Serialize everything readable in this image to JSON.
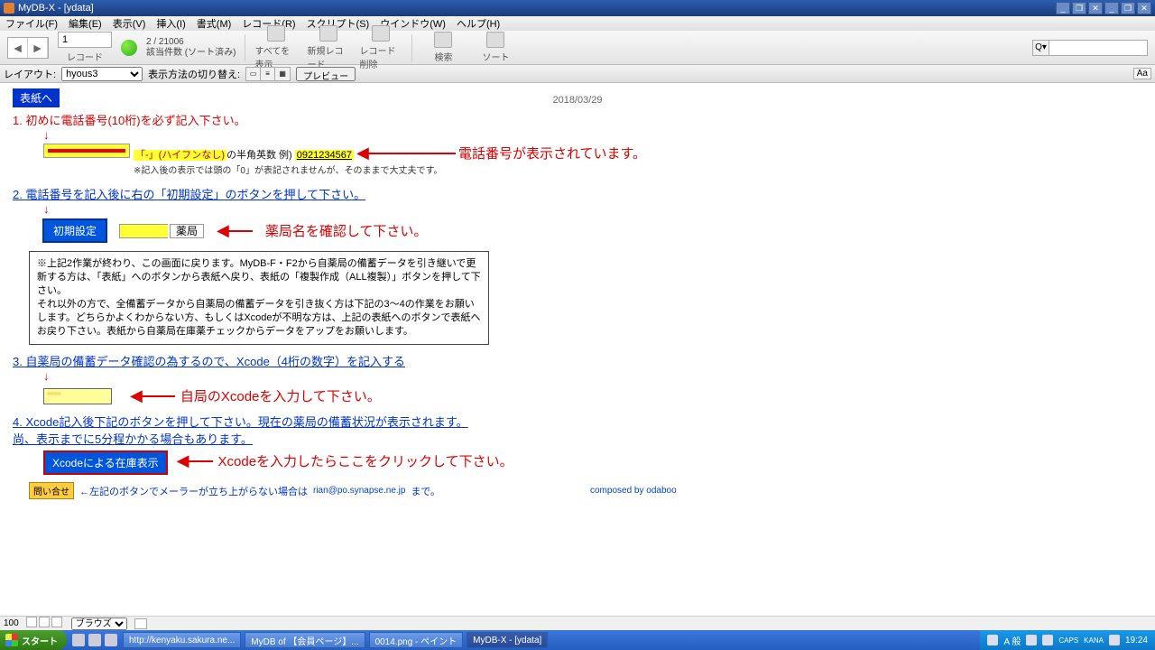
{
  "title": "MyDB-X - [ydata]",
  "menu": [
    "ファイル(F)",
    "編集(E)",
    "表示(V)",
    "挿入(I)",
    "書式(M)",
    "レコード(R)",
    "スクリプト(S)",
    "ウインドウ(W)",
    "ヘルプ(H)"
  ],
  "toolbar": {
    "record_value": "1",
    "record_label": "レコード",
    "status1": "2 / 21006",
    "status2": "該当件数 (ソート済み)",
    "btn_showall": "すべてを表示",
    "btn_new": "新規レコード",
    "btn_delete": "レコード削除",
    "btn_find": "検索",
    "btn_sort": "ソート"
  },
  "layoutbar": {
    "layout_lbl": "レイアウト:",
    "layout_value": "hyous3",
    "viewswitch_lbl": "表示方法の切り替え:",
    "preview": "プレビュー"
  },
  "body": {
    "tab": "表紙へ",
    "date": "2018/03/29",
    "s1": "1. 初めに電話番号(10桁)を必ず記入下さい。",
    "arrow": "↓",
    "tel_hint1_a": "「-」(ハイフンなし)",
    "tel_hint1_b": "の半角英数  例)",
    "tel_example": "0921234567",
    "tel_note": "※記入後の表示では頭の「0」が表記されませんが、そのままで大丈夫です。",
    "annot1": "電話番号が表示されています。",
    "s2": "2. 電話番号を記入後に右の「初期設定」のボタンを押して下さい。",
    "btn_init": "初期設定",
    "pharma": "薬局",
    "annot2": "薬局名を確認して下さい。",
    "box": "※上記2作業が終わり、この画面に戻ります。MyDB-F・F2から自薬局の備蓄データを引き継いで更新する方は、「表紙」へのボタンから表紙へ戻り、表紙の「複製作成（ALL複製）」ボタンを押して下さい。\nそれ以外の方で、全備蓄データから自薬局の備蓄データを引き抜く方は下記の3～4の作業をお願いします。どちらかよくわからない方、もしくはXcodeが不明な方は、上記の表紙へのボタンで表紙へお戻り下さい。表紙から自薬局在庫薬チェックからデータをアップをお願いします。",
    "s3": "3. 自薬局の備蓄データ確認の為するので、Xcode（4桁の数字）を記入する",
    "annot3": "自局のXcodeを入力して下さい。",
    "s4": "4. Xcode記入後下記のボタンを押して下さい。現在の薬局の備蓄状況が表示されます。尚、表示までに5分程かかる場合もあります。",
    "btn_xcode": "Xcodeによる在庫表示",
    "annot4": "Xcodeを入力したらここをクリックして下さい。",
    "toiawase": "問い合せ",
    "toi_note": "←左記のボタンでメーラーが立ち上がらない場合は",
    "mail": "rian@po.synapse.ne.jp",
    "mail_suf": "まで。",
    "composed": "composed by odaboo"
  },
  "status": {
    "zoom": "100",
    "mode": "ブラウズ"
  },
  "taskbar": {
    "start": "スタート",
    "tasks": [
      "http://kenyaku.sakura.ne...",
      "MyDB of 【会員ページ】...",
      "0014.png - ペイント",
      "MyDB-X - [ydata]"
    ],
    "ime": "A 般",
    "caps": "CAPS",
    "kana": "KANA",
    "time": "19:24"
  }
}
